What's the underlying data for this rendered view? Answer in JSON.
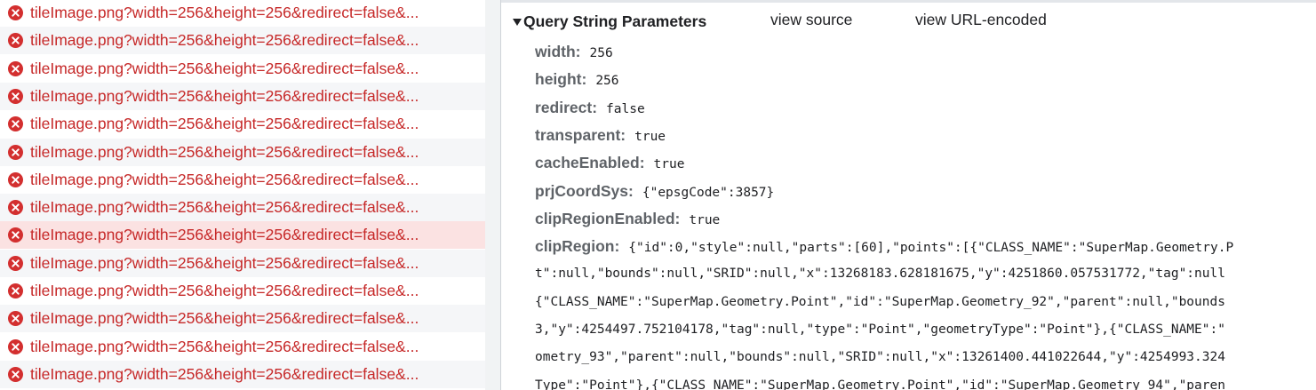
{
  "requests": [
    {
      "name": "tileImage.png?width=256&height=256&redirect=false&..."
    },
    {
      "name": "tileImage.png?width=256&height=256&redirect=false&..."
    },
    {
      "name": "tileImage.png?width=256&height=256&redirect=false&..."
    },
    {
      "name": "tileImage.png?width=256&height=256&redirect=false&..."
    },
    {
      "name": "tileImage.png?width=256&height=256&redirect=false&..."
    },
    {
      "name": "tileImage.png?width=256&height=256&redirect=false&..."
    },
    {
      "name": "tileImage.png?width=256&height=256&redirect=false&..."
    },
    {
      "name": "tileImage.png?width=256&height=256&redirect=false&..."
    },
    {
      "name": "tileImage.png?width=256&height=256&redirect=false&..."
    },
    {
      "name": "tileImage.png?width=256&height=256&redirect=false&..."
    },
    {
      "name": "tileImage.png?width=256&height=256&redirect=false&..."
    },
    {
      "name": "tileImage.png?width=256&height=256&redirect=false&..."
    },
    {
      "name": "tileImage.png?width=256&height=256&redirect=false&..."
    },
    {
      "name": "tileImage.png?width=256&height=256&redirect=false&..."
    }
  ],
  "selected_request_index": 8,
  "query_section": {
    "title": "Query String Parameters",
    "view_source": "view source",
    "view_url_encoded": "view URL-encoded"
  },
  "params": [
    {
      "key": "width:",
      "value": "256"
    },
    {
      "key": "height:",
      "value": "256"
    },
    {
      "key": "redirect:",
      "value": "false"
    },
    {
      "key": "transparent:",
      "value": "true"
    },
    {
      "key": "cacheEnabled:",
      "value": "true"
    },
    {
      "key": "prjCoordSys:",
      "value": "{\"epsgCode\":3857}"
    },
    {
      "key": "clipRegionEnabled:",
      "value": "true"
    },
    {
      "key": "clipRegion:",
      "value": "{\"id\":0,\"style\":null,\"parts\":[60],\"points\":[{\"CLASS_NAME\":\"SuperMap.Geometry.P"
    }
  ],
  "clip_region_continuation": [
    "t\":null,\"bounds\":null,\"SRID\":null,\"x\":13268183.628181675,\"y\":4251860.057531772,\"tag\":null",
    "{\"CLASS_NAME\":\"SuperMap.Geometry.Point\",\"id\":\"SuperMap.Geometry_92\",\"parent\":null,\"bounds",
    "3,\"y\":4254497.752104178,\"tag\":null,\"type\":\"Point\",\"geometryType\":\"Point\"},{\"CLASS_NAME\":\"",
    "ometry_93\",\"parent\":null,\"bounds\":null,\"SRID\":null,\"x\":13261400.441022644,\"y\":4254993.324",
    "Type\":\"Point\"},{\"CLASS_NAME\":\"SuperMap.Geometry.Point\",\"id\":\"SuperMap.Geometry_94\",\"paren"
  ],
  "colors": {
    "error": "#d32f2f",
    "request_text": "#c62828",
    "selected_row": "#fbe2e2",
    "alt_row": "#f5f6f8",
    "param_key": "#5f6368"
  },
  "icons": {
    "request_status": "error-circle-x-icon",
    "section_toggle": "triangle-down-icon"
  }
}
